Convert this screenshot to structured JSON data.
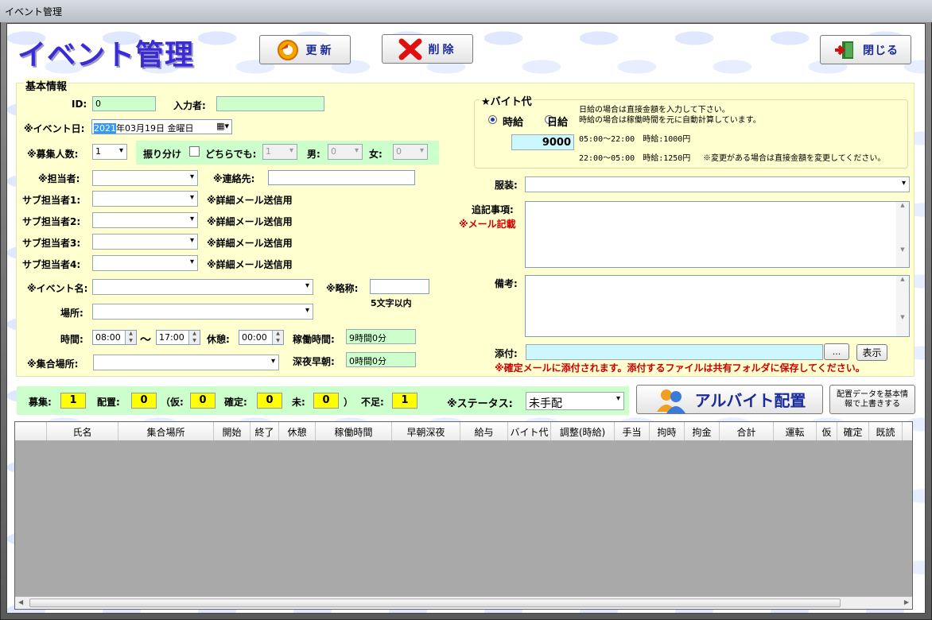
{
  "window": {
    "title": "イベント管理"
  },
  "header": {
    "app_title": "イベント管理",
    "refresh_label": "更新",
    "delete_label": "削除",
    "close_label": "閉じる"
  },
  "basic": {
    "group_label": "基本情報",
    "id_label": "ID:",
    "id_value": "0",
    "entered_by_label": "入力者:",
    "entered_by_value": "",
    "event_date_label": "※イベント日:",
    "event_date_year": "2021",
    "event_date_rest": "年03月19日 金曜日",
    "recruit_label": "※募集人数:",
    "recruit_value": "1",
    "split_label": "振り分け",
    "either_label": "どちらでも:",
    "either_value": "1",
    "male_label": "男:",
    "male_value": "0",
    "female_label": "女:",
    "female_value": "0",
    "staff_label": "※担当者:",
    "contact_label": "※連絡先:",
    "sub_staff": [
      {
        "label": "サブ担当者1:",
        "note": "※詳細メール送信用"
      },
      {
        "label": "サブ担当者2:",
        "note": "※詳細メール送信用"
      },
      {
        "label": "サブ担当者3:",
        "note": "※詳細メール送信用"
      },
      {
        "label": "サブ担当者4:",
        "note": "※詳細メール送信用"
      }
    ],
    "event_name_label": "※イベント名:",
    "abbr_label": "※略称:",
    "abbr_note": "5文字以内",
    "place_label": "場所:",
    "time_label": "時間:",
    "time_start": "08:00",
    "tilde": "～",
    "time_end": "17:00",
    "break_label": "休憩:",
    "break_value": "00:00",
    "work_time_label": "稼働時間:",
    "work_time_value": "9時間0分",
    "meet_label": "※集合場所:",
    "late_label": "深夜早朝:",
    "late_value": "0時間0分"
  },
  "pay": {
    "group_label": "★バイト代",
    "hourly_label": "時給",
    "daily_label": "日給",
    "amount": "9000",
    "note1": "日給の場合は直接金額を入力して下さい。",
    "note2": "時給の場合は稼働時間を元に自動計算しています。",
    "rate1": "05:00～22:00　時給:1000円",
    "rate2": "22:00～05:00　時給:1250円",
    "rate_note": "※変更がある場合は直接金額を変更してください。"
  },
  "right": {
    "dress_label": "服装:",
    "extra_label": "追記事項:",
    "extra_note": "※メール記載",
    "remarks_label": "備考:",
    "attach_label": "添付:",
    "browse_label": "...",
    "show_label": "表示",
    "attach_note": "※確定メールに添付されます。添付するファイルは共有フォルダに保存してください。"
  },
  "status": {
    "recruit_label": "募集:",
    "recruit_value": "1",
    "assign_label": "配置:",
    "assign_value": "0",
    "paren_open": "（仮:",
    "temp_value": "0",
    "confirmed_label": "確定:",
    "confirmed_value": "0",
    "pending_label": "未:",
    "pending_value": "0",
    "paren_close": "）",
    "shortage_label": "不足:",
    "shortage_value": "1",
    "status_label": "※ステータス:",
    "status_value": "未手配",
    "assign_button": "アルバイト配置",
    "overwrite_button": "配置データを基本情報で上書きする"
  },
  "table": {
    "columns": [
      "氏名",
      "集合場所",
      "開始",
      "終了",
      "休憩",
      "稼働時間",
      "早朝深夜",
      "給与",
      "バイト代",
      "調整(時給)",
      "手当",
      "拘時",
      "拘金",
      "合計",
      "運転",
      "仮",
      "確定",
      "既読"
    ]
  },
  "colors": {
    "title": "#3a2ad8",
    "panel": "#ffffd0",
    "status_bar": "#ccffcc",
    "highlight": "#ffff00",
    "warning": "#d00000"
  }
}
